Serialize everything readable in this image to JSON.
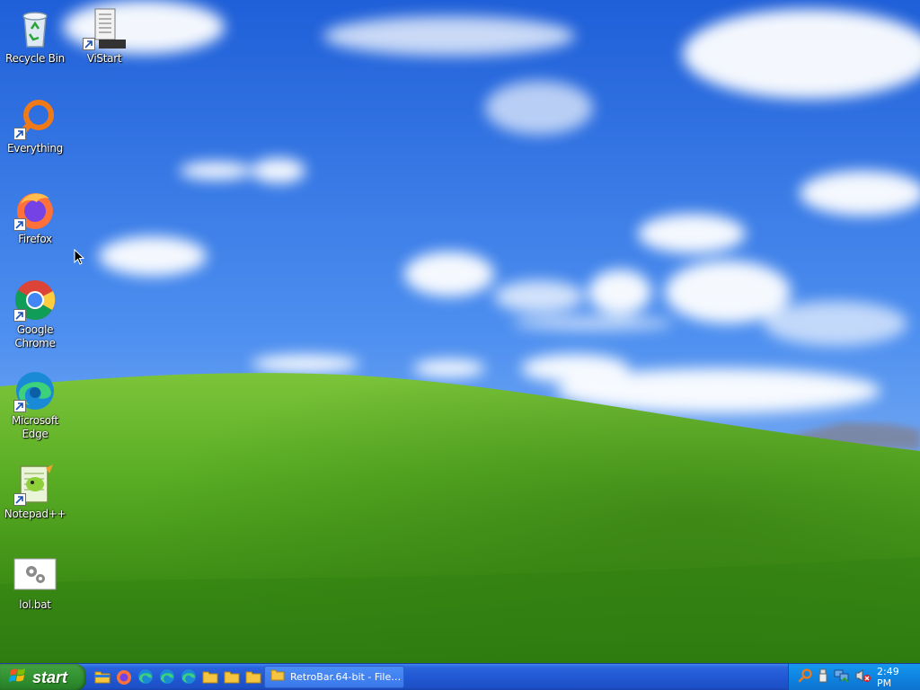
{
  "desktop": {
    "icons": [
      {
        "label": "Recycle Bin",
        "icon": "recycle-bin-icon",
        "shortcut": false
      },
      {
        "label": "ViStart",
        "icon": "vistart-icon",
        "shortcut": true
      },
      {
        "label": "Everything",
        "icon": "everything-search-icon",
        "shortcut": true
      },
      {
        "label": "Firefox",
        "icon": "firefox-icon",
        "shortcut": true
      },
      {
        "label": "Google Chrome",
        "icon": "chrome-icon",
        "shortcut": true
      },
      {
        "label": "Microsoft Edge",
        "icon": "edge-icon",
        "shortcut": true
      },
      {
        "label": "Notepad++",
        "icon": "notepadpp-icon",
        "shortcut": true
      },
      {
        "label": "lol.bat",
        "icon": "batch-file-icon",
        "shortcut": false
      }
    ]
  },
  "taskbar": {
    "start_label": "start",
    "quick_launch": [
      "file-explorer-icon",
      "firefox-icon",
      "edge-icon",
      "edge-icon",
      "edge-icon",
      "folder-icon",
      "folder-icon",
      "folder-icon"
    ],
    "task_button_label": "RetroBar.64-bit - File E...",
    "tray_icons": [
      "everything-search-icon",
      "usb-icon",
      "network-icon",
      "volume-muted-icon"
    ],
    "clock": "2:49 PM"
  },
  "colors": {
    "sky": "#2f6fe0",
    "hill": "#4fa520",
    "taskbar": "#2158d4",
    "start_button": "#3c9a3a",
    "tray": "#0e84e0"
  }
}
